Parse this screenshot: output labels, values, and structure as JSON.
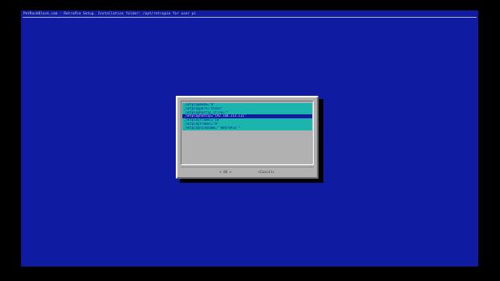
{
  "window": {
    "backtitle": "PetRockBlock.com - RetroPie Setup. Installation folder: /opt/retropie for user pi"
  },
  "menu": {
    "items": [
      "_netplaymode=\"0\"",
      "_netplayport=\"55435\"",
      "_netplayhostip_cfile=\"\"",
      "_netplayhostip=\"192.168.213.111\"",
      "_netplayframes=\"10\"",
      "_netplayframes=\"0\"",
      "_netplaynickname=\"'RetroPie'\""
    ],
    "selected_index": 3
  },
  "buttons": {
    "ok": "< OK >",
    "cancel": "<Cancel>"
  },
  "colors": {
    "background": "#0f1ba0",
    "dialog": "#b1b1b1",
    "item": "#1bb5ae",
    "selected": "#0f1ba0"
  }
}
